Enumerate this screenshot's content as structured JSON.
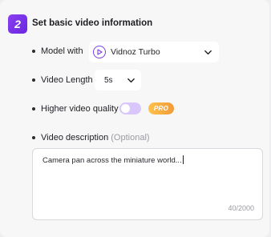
{
  "section": {
    "step_number": "2",
    "title": "Set basic video information"
  },
  "model": {
    "label": "Model with",
    "selected": "Vidnoz Turbo",
    "icon": "play-circle-icon"
  },
  "video_length": {
    "label": "Video Length",
    "selected": "5s"
  },
  "quality": {
    "label": "Higher video quality",
    "toggle_on": false,
    "badge": "PRO"
  },
  "description": {
    "label": "Video description",
    "optional_label": "(Optional)",
    "value": "Camera pan across the miniature world...",
    "counter": "40/2000"
  },
  "colors": {
    "accent": "#7a3fe6",
    "toggle_track": "#d9c6fb",
    "pro_badge": "#f5a83c"
  }
}
